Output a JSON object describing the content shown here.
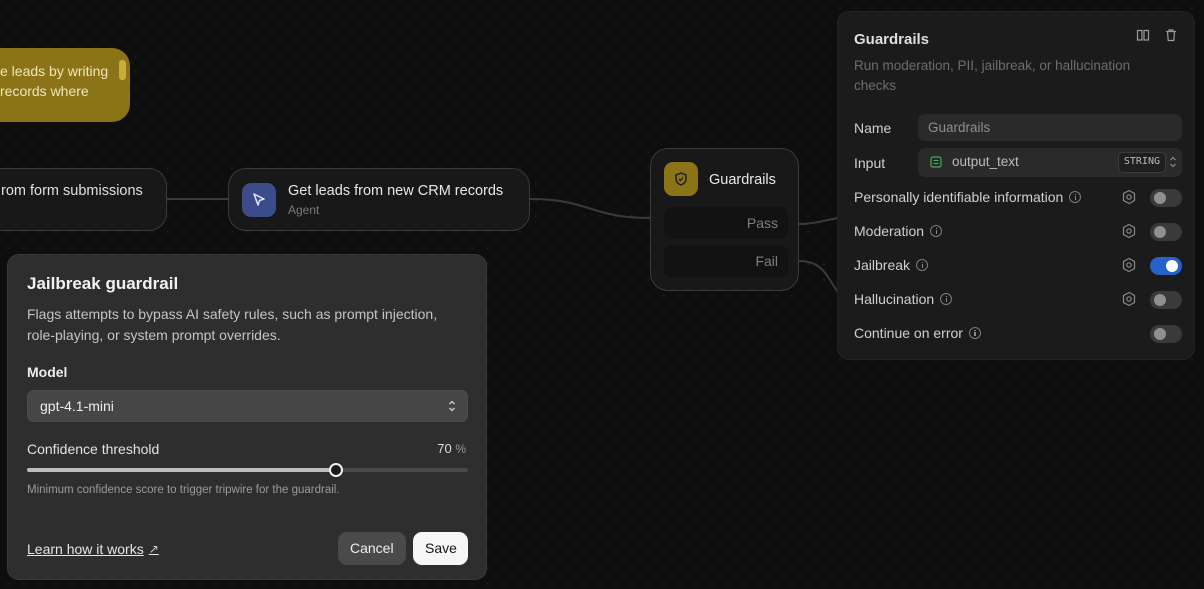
{
  "canvas": {
    "note": {
      "text_line1": "e leads by writing",
      "text_line2": "records where"
    },
    "form_node": {
      "title": "rom form submissions"
    },
    "crm_node": {
      "title": "Get leads from new CRM records",
      "subtitle": "Agent",
      "icon": "cursor-icon"
    },
    "guardrails_node": {
      "title": "Guardrails",
      "icon": "shield-icon",
      "pass_label": "Pass",
      "fail_label": "Fail"
    }
  },
  "panel": {
    "title": "Guardrails",
    "description": "Run moderation, PII, jailbreak, or hallucination checks",
    "name_label": "Name",
    "name_value": "Guardrails",
    "input_label": "Input",
    "input_value": "output_text",
    "input_type": "STRING",
    "checks": [
      {
        "label": "Personally identifiable information",
        "enabled": false
      },
      {
        "label": "Moderation",
        "enabled": false
      },
      {
        "label": "Jailbreak",
        "enabled": true
      },
      {
        "label": "Hallucination",
        "enabled": false
      }
    ],
    "continue_label": "Continue on error",
    "continue_enabled": false
  },
  "dialog": {
    "title": "Jailbreak guardrail",
    "description": "Flags attempts to bypass AI safety rules, such as prompt injection, role-playing, or system prompt overrides.",
    "model_label": "Model",
    "model_value": "gpt-4.1-mini",
    "confidence_label": "Confidence threshold",
    "confidence_value": "70",
    "confidence_unit": "%",
    "confidence_fraction": 0.7,
    "hint": "Minimum confidence score to trigger tripwire for the guardrail.",
    "learn_link": "Learn how it works",
    "cancel_label": "Cancel",
    "save_label": "Save"
  },
  "colors": {
    "accent_toggle": "#2563c9",
    "guardrail_icon_bg": "#8b7418",
    "agent_icon_bg": "#3c4b8a"
  }
}
